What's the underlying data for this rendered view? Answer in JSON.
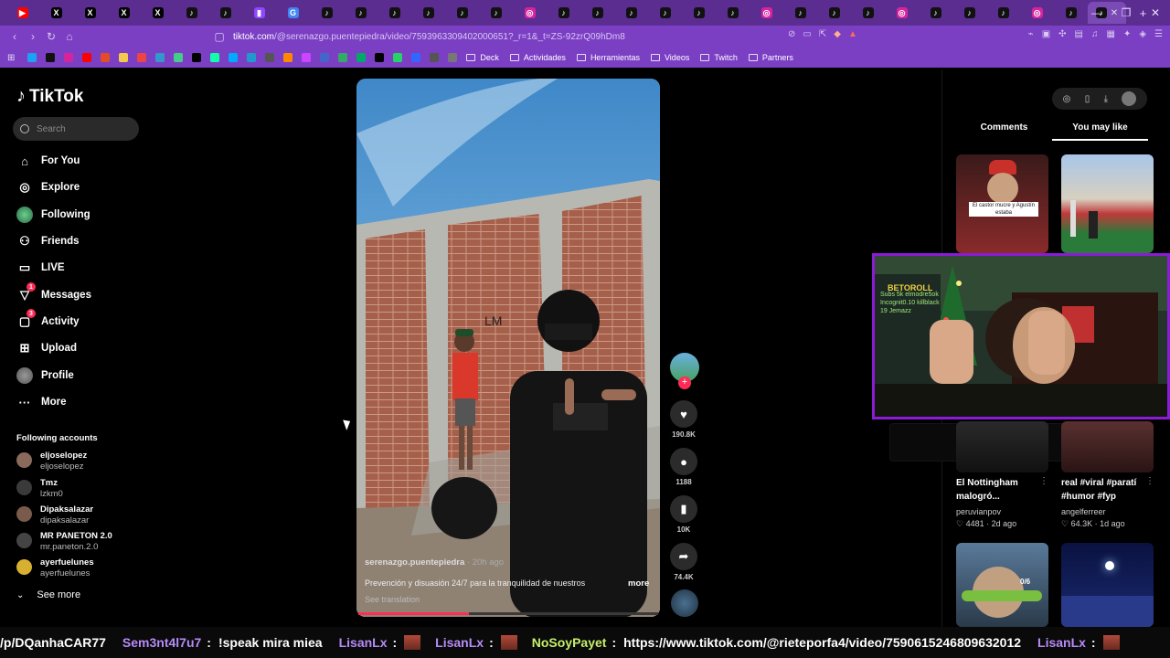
{
  "browser": {
    "tab_favicons": [
      "yt",
      "X",
      "X",
      "X",
      "X",
      "tt",
      "tt",
      "tw",
      "gg",
      "tt",
      "tt",
      "tt",
      "tt",
      "tt",
      "tt",
      "ig",
      "tt",
      "tt",
      "tt",
      "tt",
      "tt",
      "tt",
      "ig",
      "tt",
      "tt",
      "tt",
      "ig",
      "tt",
      "tt",
      "tt",
      "ig",
      "tt"
    ],
    "active_tab_close": "✕",
    "new_tab": "+",
    "window_controls": [
      "—",
      "❐",
      "✕"
    ],
    "url_domain": "tiktok.com",
    "url_path": "/@serenazgo.puentepiedra/video/7593963309402000651?_r=1&_t=ZS-92zrQ09hDm8",
    "bookmarks": [
      {
        "label": "Deck"
      },
      {
        "label": "Actividades"
      },
      {
        "label": "Herramientas"
      },
      {
        "label": "Videos"
      },
      {
        "label": "Twitch"
      },
      {
        "label": "Partners"
      }
    ]
  },
  "tiktok": {
    "logo": "TikTok",
    "search_placeholder": "Search",
    "nav": [
      {
        "label": "For You",
        "icon": "home-icon"
      },
      {
        "label": "Explore",
        "icon": "compass-icon"
      },
      {
        "label": "Following",
        "icon": "following-avatar-icon"
      },
      {
        "label": "Friends",
        "icon": "friends-icon"
      },
      {
        "label": "LIVE",
        "icon": "live-icon"
      },
      {
        "label": "Messages",
        "icon": "messages-icon",
        "badge": "1"
      },
      {
        "label": "Activity",
        "icon": "activity-icon",
        "badge": "3"
      },
      {
        "label": "Upload",
        "icon": "upload-icon"
      },
      {
        "label": "Profile",
        "icon": "profile-avatar-icon"
      },
      {
        "label": "More",
        "icon": "more-icon"
      }
    ],
    "following_title": "Following accounts",
    "following": [
      {
        "name": "eljoselopez",
        "handle": "eljoselopez"
      },
      {
        "name": "Tmz",
        "handle": "lzkm0"
      },
      {
        "name": "Dipaksalazar",
        "handle": "dipaksalazar"
      },
      {
        "name": "MR PANETON 2.0",
        "handle": "mr.paneton.2.0"
      },
      {
        "name": "ayerfuelunes",
        "handle": "ayerfuelunes"
      }
    ],
    "see_more": "See more"
  },
  "video": {
    "author": "serenazgo.puentepiedra",
    "time": "· 20h ago",
    "description": "Prevención y disuasión 24/7 para la tranquilidad de nuestros",
    "more": "more",
    "translation": "See translation",
    "progress": 0.37,
    "actions": {
      "likes": "190.8K",
      "comments": "1188",
      "saves": "10K",
      "shares": "74.4K"
    }
  },
  "right_panel": {
    "tabs": [
      "Comments",
      "You may like"
    ],
    "active_tab": "You may like",
    "cards": [
      {
        "title": "El Nottingham malogró...",
        "author": "peruvianpov",
        "stats": "♡ 4481 · 2d ago"
      },
      {
        "title": "real #viral #paratí #humor #fyp",
        "author": "angelferreer",
        "stats": "♡ 64.3K · 1d ago"
      }
    ],
    "top_caption": "El castor mucre y Agustín estaba"
  },
  "stream_overlay": {
    "sign": "BETOROLL",
    "chalk": "Subs 5k elmodre5ok Incognit0.10 killblack 19 Jemazz"
  },
  "chat": [
    {
      "user": "",
      "message": "/p/DQanhaCAR77",
      "color": "#ffffff"
    },
    {
      "user": "Sem3nt4l7u7",
      "message": "!speak mira miea",
      "color": "#b78bf7"
    },
    {
      "user": "LisanLx",
      "message": "",
      "color": "#b78bf7"
    },
    {
      "user": "LisanLx",
      "message": "",
      "color": "#b78bf7"
    },
    {
      "user": "NoSoyPayet",
      "message": "https://www.tiktok.com/@rieteporfa4/video/7590615246809632012",
      "color": "#c5f06a"
    },
    {
      "user": "LisanLx",
      "message": "",
      "color": "#b78bf7"
    }
  ],
  "colors": {
    "accent": "#fe2c55",
    "browser": "#7b3fc4",
    "stream_border": "#8a1bd6"
  }
}
